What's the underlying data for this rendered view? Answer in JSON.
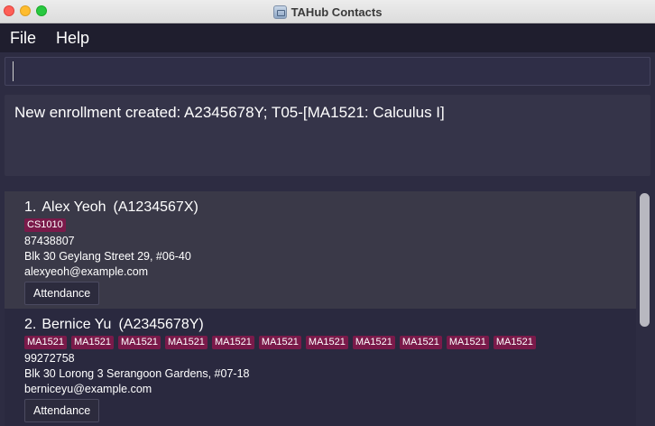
{
  "window": {
    "title": "TAHub Contacts"
  },
  "menu": {
    "items": [
      "File",
      "Help"
    ]
  },
  "command": {
    "value": "",
    "placeholder": ""
  },
  "result": {
    "message": "New enrollment created: A2345678Y; T05-[MA1521: Calculus I]"
  },
  "contacts": [
    {
      "index": "1.",
      "name": "Alex Yeoh",
      "id": "(A1234567X)",
      "tags": [
        "CS1010"
      ],
      "phone": "87438807",
      "address": "Blk 30 Geylang Street 29, #06-40",
      "email": "alexyeoh@example.com",
      "button": "Attendance"
    },
    {
      "index": "2.",
      "name": "Bernice Yu",
      "id": "(A2345678Y)",
      "tags": [
        "MA1521",
        "MA1521",
        "MA1521",
        "MA1521",
        "MA1521",
        "MA1521",
        "MA1521",
        "MA1521",
        "MA1521",
        "MA1521",
        "MA1521"
      ],
      "phone": "99272758",
      "address": "Blk 30 Lorong 3 Serangoon Gardens, #07-18",
      "email": "berniceyu@example.com",
      "button": "Attendance"
    }
  ],
  "colors": {
    "tag": "#7a1a4a",
    "background": "#2d2c42"
  }
}
